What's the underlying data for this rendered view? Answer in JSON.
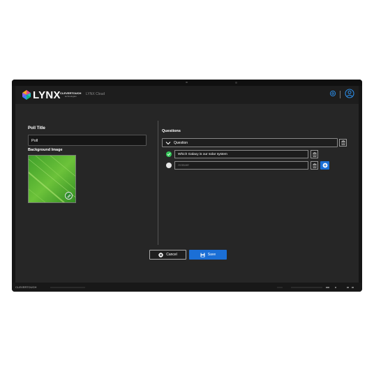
{
  "header": {
    "logo_text": "LYNX",
    "brand_small": "CLEVERTOUCH",
    "brand_sub": "technologies",
    "app_name": "LYNX Cloud"
  },
  "left": {
    "poll_title_label": "Poll Title",
    "poll_title_value": "Poll",
    "background_label": "Background Image"
  },
  "right": {
    "questions_label": "Questions",
    "question_label": "Question",
    "answers": [
      {
        "text": "Which Galaxy is our solar system",
        "correct": true
      },
      {
        "placeholder": "Answer",
        "correct": false
      }
    ]
  },
  "buttons": {
    "cancel": "Cancel",
    "save": "Save"
  },
  "bezel": {
    "brand": "CLEVERTOUCH"
  },
  "colors": {
    "accent_blue": "#1b6fd6",
    "correct_green": "#34c759",
    "screen_bg": "#262626"
  }
}
